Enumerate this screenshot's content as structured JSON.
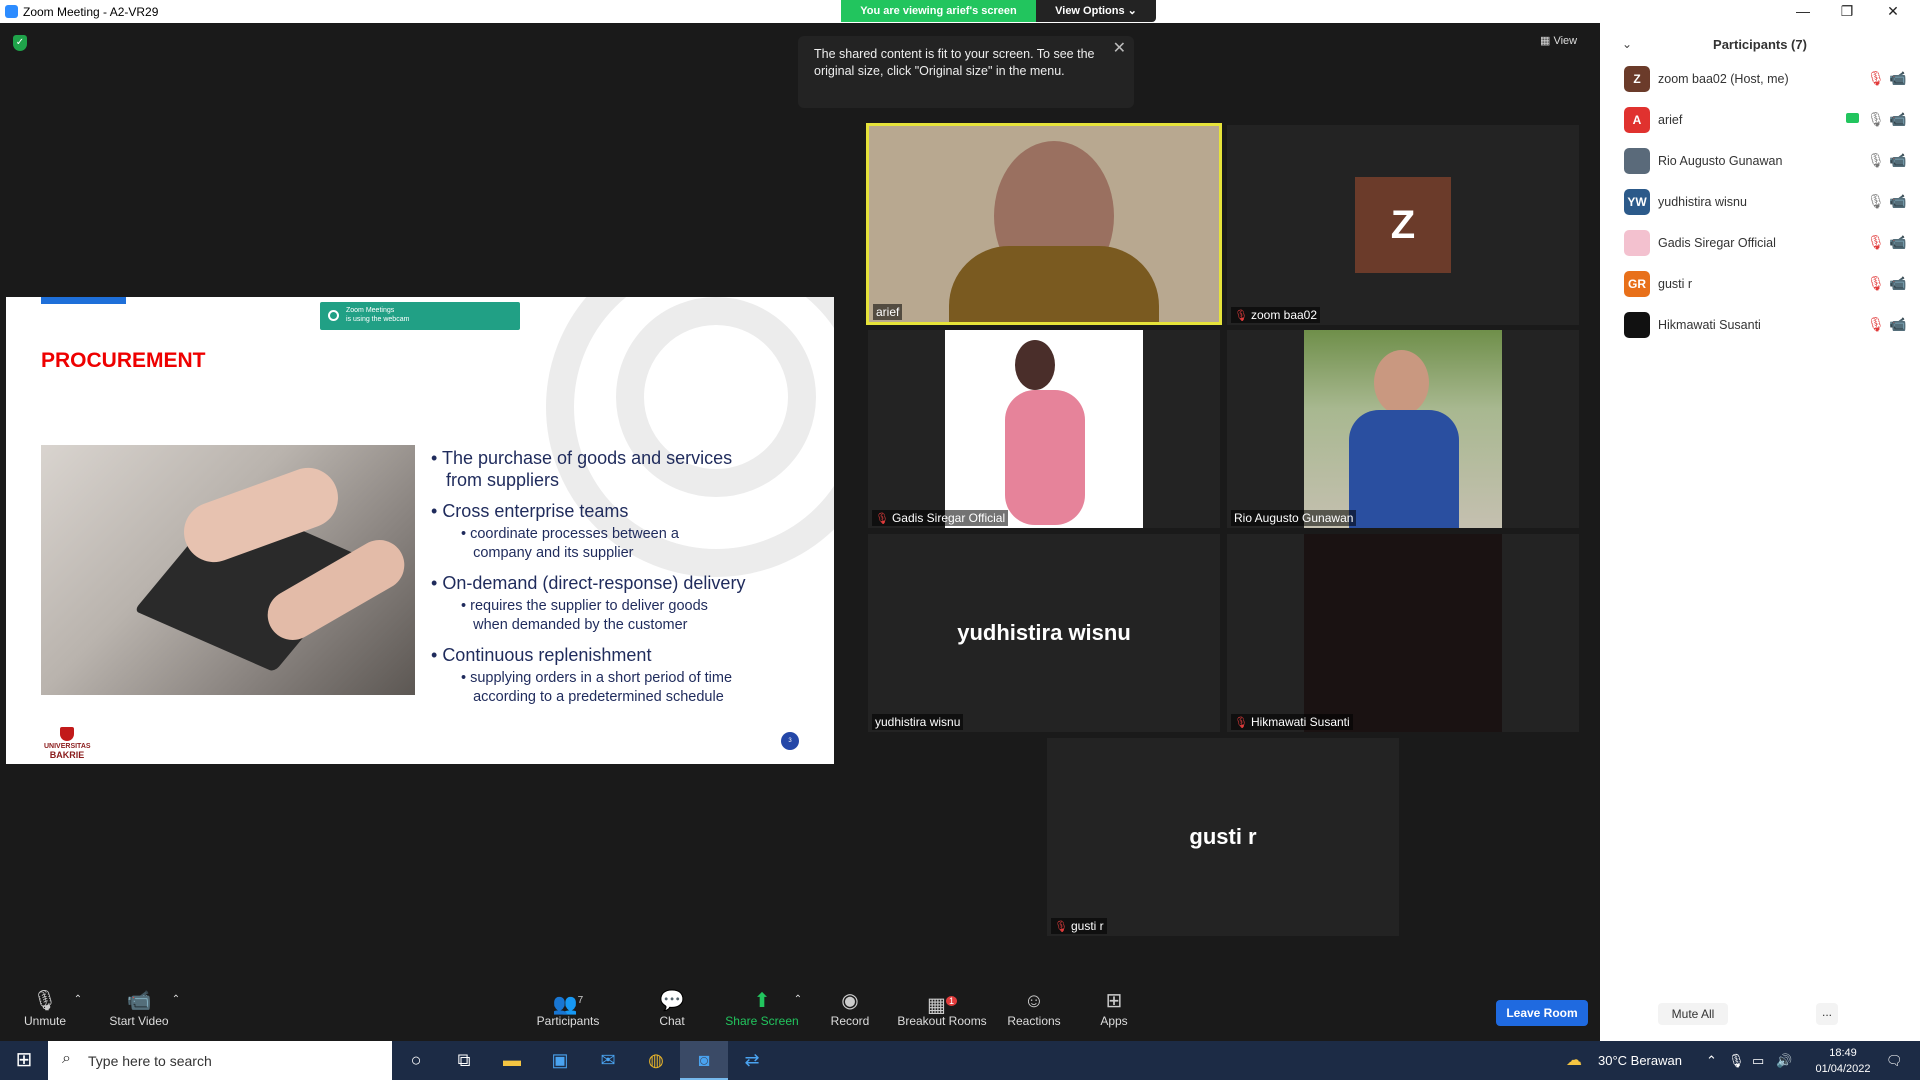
{
  "window": {
    "title": "Zoom Meeting - A2-VR29",
    "minimize": "—",
    "restore": "❐",
    "close": "✕"
  },
  "banner": {
    "viewing": "You are viewing arief's screen",
    "view_options": "View Options ⌄"
  },
  "tooltip": {
    "text": "The shared content is fit to your screen. To see the original size, click \"Original size\" in the menu.",
    "close": "✕"
  },
  "view_button": "▦ View",
  "slide": {
    "title": "PROCUREMENT",
    "webcam_notice_line1": "Zoom Meetings",
    "webcam_notice_line2": "is using the webcam",
    "bullets": [
      {
        "text": "The purchase of goods and services",
        "text2": "from suppliers"
      },
      {
        "text": "Cross enterprise teams",
        "sub1": "coordinate processes between a",
        "sub2": "company and its supplier"
      },
      {
        "text": "On-demand (direct-response) delivery",
        "sub1": "requires the supplier to deliver goods",
        "sub2": "when demanded by the customer"
      },
      {
        "text": "Continuous replenishment",
        "sub1": "supplying orders in a short period of time",
        "sub2": "according to a predetermined schedule"
      }
    ],
    "logo_line1": "UNIVERSITAS",
    "logo_line2": "BAKRIE",
    "page_number": "3"
  },
  "tiles": {
    "arief": {
      "name": "arief"
    },
    "zoom_baa02": {
      "name": "zoom baa02",
      "initial": "Z"
    },
    "gadis": {
      "name": "Gadis Siregar Official"
    },
    "rio": {
      "name": "Rio Augusto Gunawan"
    },
    "yudhistira": {
      "name": "yudhistira wisnu",
      "display": "yudhistira wisnu"
    },
    "hikmawati": {
      "name": "Hikmawati Susanti"
    },
    "gusti": {
      "name": "gusti r",
      "display": "gusti r"
    }
  },
  "toolbar": {
    "unmute": "Unmute",
    "start_video": "Start Video",
    "participants": "Participants",
    "participants_count": "7",
    "chat": "Chat",
    "share_screen": "Share Screen",
    "record": "Record",
    "breakout_rooms": "Breakout Rooms",
    "breakout_badge": "1",
    "reactions": "Reactions",
    "apps": "Apps",
    "leave": "Leave Room"
  },
  "panel": {
    "title": "Participants (7)",
    "participants": [
      {
        "name": "zoom baa02 (Host, me)",
        "initial": "Z",
        "color": "#6b3b2a"
      },
      {
        "name": "arief",
        "initial": "A",
        "color": "#e0322f"
      },
      {
        "name": "Rio Augusto Gunawan",
        "initial": "",
        "color": "#5a6a7a"
      },
      {
        "name": "yudhistira wisnu",
        "initial": "YW",
        "color": "#2c5a8a"
      },
      {
        "name": "Gadis Siregar Official",
        "initial": "",
        "color": "#f3c1cf"
      },
      {
        "name": "gusti r",
        "initial": "GR",
        "color": "#e8701a"
      },
      {
        "name": "Hikmawati Susanti",
        "initial": "",
        "color": "#111111"
      }
    ],
    "mute_all": "Mute All",
    "more": "..."
  },
  "taskbar": {
    "search_placeholder": "Type here to search",
    "weather": "30°C  Berawan",
    "time": "18:49",
    "date": "01/04/2022"
  }
}
